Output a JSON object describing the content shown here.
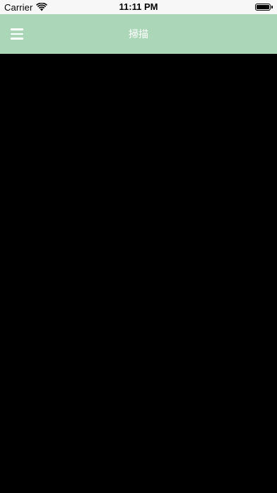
{
  "status_bar": {
    "carrier": "Carrier",
    "time": "11:11 PM",
    "wifi_icon": "wifi-icon",
    "battery_icon": "battery-icon",
    "battery_level": 1.0
  },
  "nav_bar": {
    "title": "掃描",
    "menu_icon": "hamburger-menu-icon",
    "background_color": "#abd7b8",
    "title_color": "#ffffff"
  },
  "content": {
    "background_color": "#000000"
  }
}
